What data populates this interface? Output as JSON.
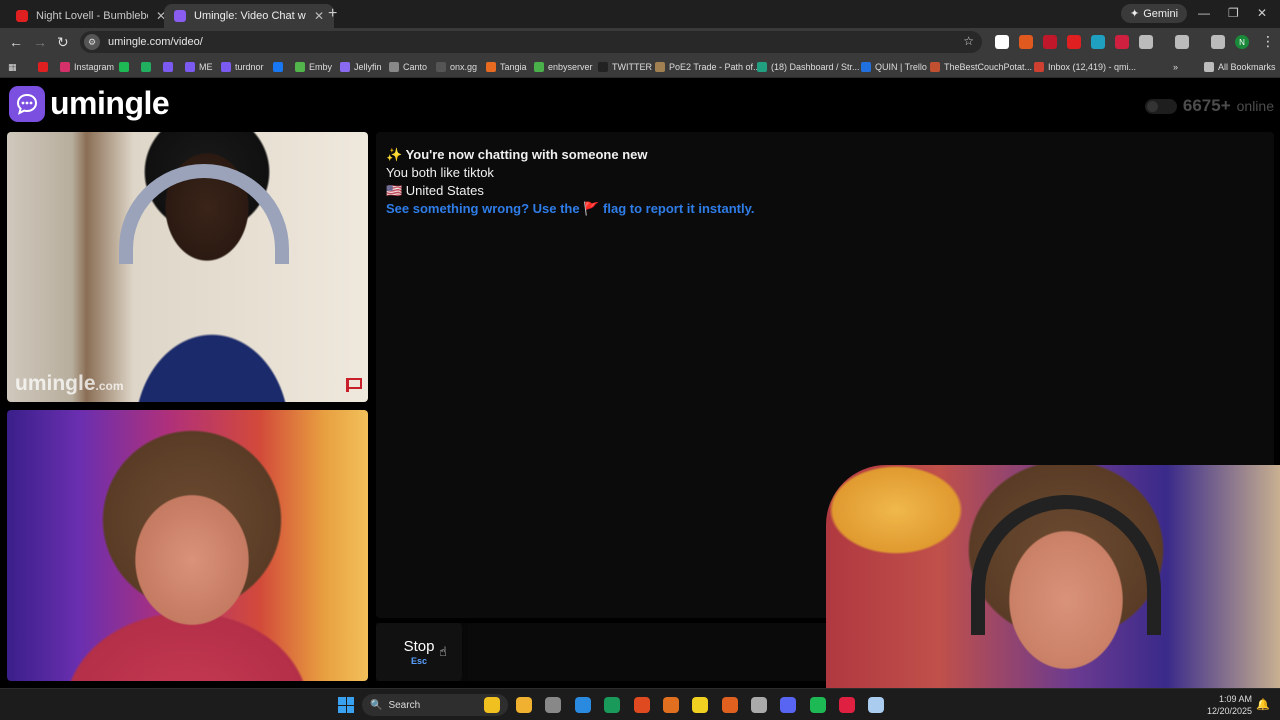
{
  "browser": {
    "tabs": [
      {
        "title": "Night Lovell - Bumblebee (KEIF",
        "close": "✕",
        "color": "#e02020",
        "active": false
      },
      {
        "title": "Umingle: Video Chat with S",
        "close": "✕",
        "color": "#8a5cf0",
        "active": true
      }
    ],
    "new_tab": "+",
    "gemini_label": "Gemini",
    "gemini_icon": "✦",
    "window_controls": {
      "minimize": "—",
      "restore": "❐",
      "close": "✕"
    },
    "nav": {
      "back": "←",
      "forward": "→",
      "reload": "↻"
    },
    "url": "umingle.com/video/",
    "bookmark_star": "☆",
    "extensions": [
      "#ffffff",
      "#e05a20",
      "#c0182a",
      "#e02020",
      "#20a0c0",
      "#d02040",
      "#bbbbbb",
      "#bbbbbb",
      "#bbbbbb",
      "#1a8a3a"
    ],
    "profile_initial": "N",
    "bookmarks": [
      {
        "label": "",
        "color": "#e02020"
      },
      {
        "label": "Instagram",
        "color": "#d6306a"
      },
      {
        "label": "",
        "color": "#1db954"
      },
      {
        "label": "",
        "color": "#20b060"
      },
      {
        "label": "",
        "color": "#7a5af0"
      },
      {
        "label": "ME",
        "color": "#7a5af0"
      },
      {
        "label": "turdnor",
        "color": "#7a5af0"
      },
      {
        "label": "",
        "color": "#1877f2"
      },
      {
        "label": "Emby",
        "color": "#52b54b"
      },
      {
        "label": "Jellyfin",
        "color": "#8a6af0"
      },
      {
        "label": "Canto",
        "color": "#888888"
      },
      {
        "label": "onx.gg",
        "color": "#555555"
      },
      {
        "label": "Tangia",
        "color": "#e86a20"
      },
      {
        "label": "enbyserver",
        "color": "#4ab04a"
      },
      {
        "label": "TWITTER",
        "color": "#222222"
      },
      {
        "label": "PoE2 Trade - Path of...",
        "color": "#a08050"
      },
      {
        "label": "(18) Dashboard / Str...",
        "color": "#20a080"
      },
      {
        "label": "QUIN | Trello",
        "color": "#2070e0"
      },
      {
        "label": "TheBestCouchPotat...",
        "color": "#c05030"
      },
      {
        "label": "Inbox (12,419) - qmi...",
        "color": "#d04030"
      }
    ],
    "bookmarks_more": "»",
    "all_bookmarks": "All Bookmarks"
  },
  "page": {
    "logo_text": "umingle",
    "online_count": "6675+",
    "online_label": "online",
    "remote_watermark": "umingle",
    "remote_watermark_suffix": ".com",
    "chat": {
      "line1": "✨ You're now chatting with someone new",
      "line2": "You both like tiktok",
      "line3": "🇺🇸 United States",
      "report_pre": "See something wrong? Use the",
      "report_flag": "🚩",
      "report_post": "flag to report it instantly."
    },
    "stop_label": "Stop",
    "stop_key": "Esc",
    "message_placeholder": ""
  },
  "taskbar": {
    "search_label": "Search",
    "search_icon": "🔍",
    "apps": [
      "#f0c020",
      "#f0b030",
      "#888888",
      "#2a8ae0",
      "#1a9a5a",
      "#e04a20",
      "#e07020",
      "#f0d020",
      "#e06020",
      "#aaaaaa",
      "#5865f2",
      "#1db954",
      "#e02040",
      "#aaccee"
    ],
    "time": "1:09 AM",
    "date": "12/20/2025",
    "bell": "🔔"
  }
}
